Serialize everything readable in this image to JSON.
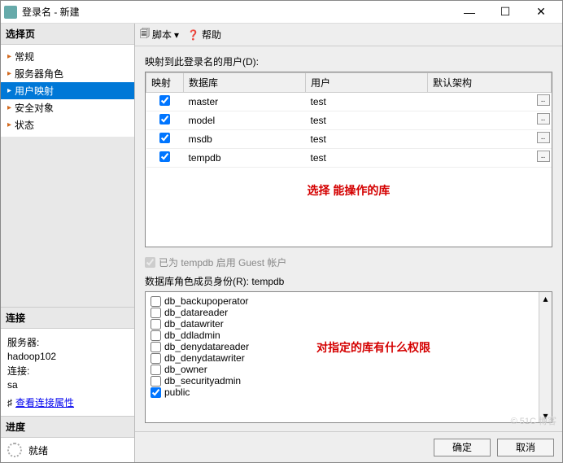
{
  "window": {
    "title": "登录名 - 新建"
  },
  "sidebar": {
    "select_page": "选择页",
    "items": [
      {
        "label": "常规"
      },
      {
        "label": "服务器角色"
      },
      {
        "label": "用户映射"
      },
      {
        "label": "安全对象"
      },
      {
        "label": "状态"
      }
    ],
    "connection": {
      "head": "连接",
      "server_lbl": "服务器:",
      "server": "hadoop102",
      "conn_lbl": "连接:",
      "conn": "sa",
      "view_props": "查看连接属性"
    },
    "progress": {
      "head": "进度",
      "status": "就绪"
    }
  },
  "toolbar": {
    "script": "脚本",
    "help": "帮助"
  },
  "main": {
    "mapping_label": "映射到此登录名的用户(D):",
    "cols": {
      "map": "映射",
      "db": "数据库",
      "user": "用户",
      "schema": "默认架构"
    },
    "rows": [
      {
        "db": "master",
        "user": "test",
        "schema": ""
      },
      {
        "db": "model",
        "user": "test",
        "schema": ""
      },
      {
        "db": "msdb",
        "user": "test",
        "schema": ""
      },
      {
        "db": "tempdb",
        "user": "test",
        "schema": ""
      }
    ],
    "annotation1": "选择 能操作的库",
    "guest": "已为 tempdb 启用 Guest 帐户",
    "roles_label_prefix": "数据库角色成员身份(R): ",
    "roles_db": "tempdb",
    "roles": [
      {
        "name": "db_backupoperator",
        "checked": false
      },
      {
        "name": "db_datareader",
        "checked": false
      },
      {
        "name": "db_datawriter",
        "checked": false
      },
      {
        "name": "db_ddladmin",
        "checked": false
      },
      {
        "name": "db_denydatareader",
        "checked": false
      },
      {
        "name": "db_denydatawriter",
        "checked": false
      },
      {
        "name": "db_owner",
        "checked": false
      },
      {
        "name": "db_securityadmin",
        "checked": false
      },
      {
        "name": "public",
        "checked": true
      }
    ],
    "annotation2": "对指定的库有什么权限"
  },
  "footer": {
    "ok": "确定",
    "cancel": "取消"
  },
  "watermark": "© 51C 博客"
}
